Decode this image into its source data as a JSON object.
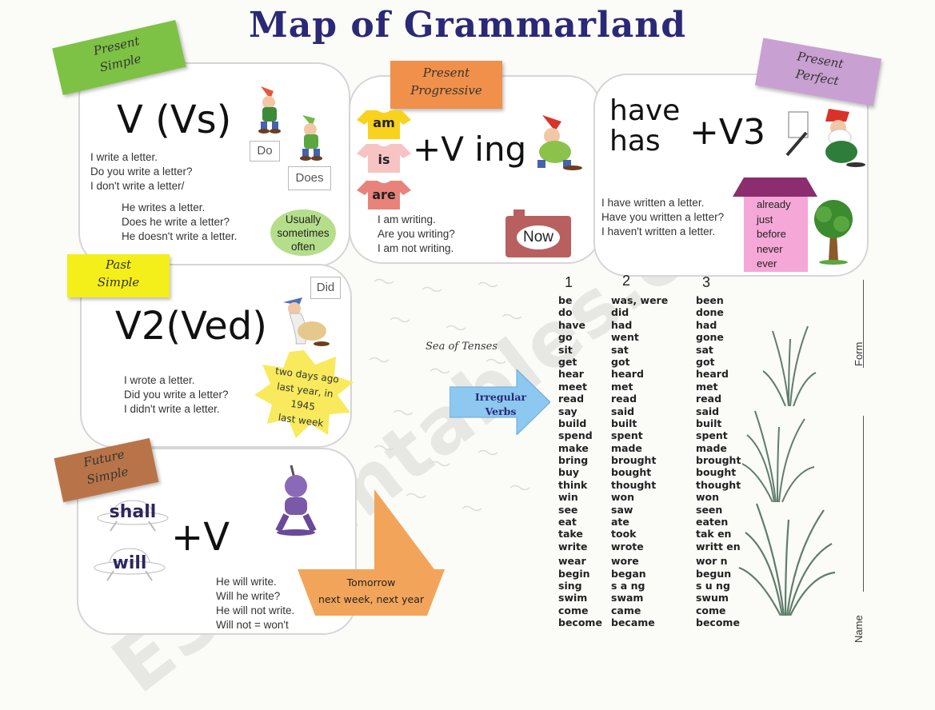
{
  "title": "Map of Grammarland",
  "watermark": "ESLprintables.com",
  "present_simple": {
    "tag": [
      "Present",
      "Simple"
    ],
    "formula": "V (Vs)",
    "aux": [
      "Do",
      "Does"
    ],
    "examples_i": [
      "I write a letter.",
      "Do you write a letter?",
      "I don't write a letter/"
    ],
    "examples_he": [
      "He writes a letter.",
      "Does he write a letter?",
      "He doesn't write a letter."
    ],
    "adverbs": [
      "Usually",
      "sometimes",
      "often"
    ]
  },
  "present_progressive": {
    "tag": [
      "Present",
      "Progressive"
    ],
    "be": [
      "am",
      "is",
      "are"
    ],
    "formula": "+V ing",
    "sign": "Now",
    "examples": [
      "I am writing.",
      "Are you writing?",
      "I am not writing."
    ]
  },
  "present_perfect": {
    "tag": [
      "Present",
      "Perfect"
    ],
    "have": [
      "have",
      "has"
    ],
    "formula": "+V3",
    "examples": [
      "I have written a letter.",
      "Have you written a letter?",
      "I haven't written a letter."
    ],
    "house_words": [
      "already",
      "just",
      "before",
      "never",
      "ever"
    ]
  },
  "past_simple": {
    "tag": [
      "Past",
      "Simple"
    ],
    "formula": "V2(Ved)",
    "aux": "Did",
    "examples": [
      "I wrote a letter.",
      "Did you write a letter?",
      "I didn't write a letter."
    ],
    "time_words": [
      "two days ago",
      "last year, in 1945",
      "last week"
    ]
  },
  "future_simple": {
    "tag": [
      "Future",
      "Simple"
    ],
    "aux": [
      "shall",
      "will"
    ],
    "formula": "+V",
    "examples": [
      "He will write.",
      "Will he write?",
      "He will not write.",
      "Will not = won't"
    ],
    "boat_words": [
      "Tomorrow",
      "next week, next year"
    ]
  },
  "sea_label": "Sea of Tenses",
  "irregular_label": [
    "Irregular",
    "Verbs"
  ],
  "verb_table": {
    "headers": [
      "1",
      "2",
      "3"
    ],
    "rows": [
      [
        "be",
        "was, were",
        "been"
      ],
      [
        "do",
        "did",
        "done"
      ],
      [
        "have",
        "had",
        "had"
      ],
      [
        "go",
        "went",
        "gone"
      ],
      [
        "sit",
        "sat",
        "sat"
      ],
      [
        "get",
        "got",
        "got"
      ],
      [
        "hear",
        "heard",
        "heard"
      ],
      [
        "meet",
        "met",
        "met"
      ],
      [
        "read",
        "read",
        "read"
      ],
      [
        "say",
        "said",
        "said"
      ],
      [
        "build",
        "built",
        "built"
      ],
      [
        "spend",
        "spent",
        "spent"
      ],
      [
        "make",
        "made",
        "made"
      ],
      [
        "bring",
        "brought",
        "brought"
      ],
      [
        "buy",
        "bought",
        "bought"
      ],
      [
        "think",
        "thought",
        "thought"
      ],
      [
        "win",
        "won",
        "won"
      ],
      [
        "see",
        "saw",
        "seen"
      ],
      [
        "eat",
        "ate",
        "eaten"
      ],
      [
        "take",
        "took",
        "tak en"
      ],
      [
        "write",
        "wrote",
        "writt en"
      ],
      [
        "wear",
        "wore",
        "wor n"
      ],
      [
        "begin",
        "began",
        "begun"
      ],
      [
        "sing",
        "s a ng",
        "s u ng"
      ],
      [
        "swim",
        "swam",
        "swum"
      ],
      [
        "come",
        "came",
        "come"
      ],
      [
        "become",
        "became",
        "become"
      ]
    ]
  },
  "form_label": "Form",
  "name_label": "Name",
  "colors": {
    "title": "#2b2878",
    "present_simple_tag": "#7dc244",
    "progressive_tag": "#f0904a",
    "perfect_tag": "#c9a0d2",
    "past_tag": "#f4ee1a",
    "future_tag": "#b87448",
    "shirt_yellow": "#f8d21c",
    "shirt_pink": "#f7c3c3",
    "shirt_red": "#e8837c",
    "arrow_blue": "#8cc8f0",
    "boat_orange": "#f2a55a"
  }
}
